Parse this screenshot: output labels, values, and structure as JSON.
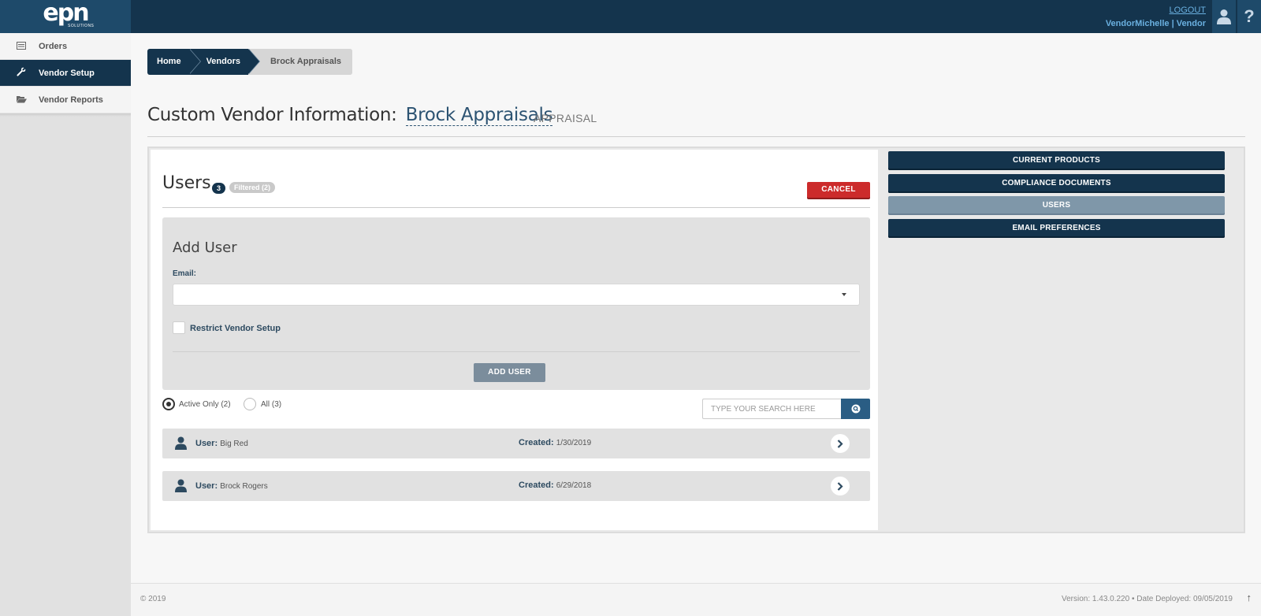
{
  "header": {
    "logo_text": "epn",
    "logo_sub": "SOLUTIONS",
    "logout_label": "LOGOUT",
    "user_label": "VendorMichelle | Vendor",
    "user_icon": "user-icon",
    "help_icon": "help-icon",
    "help_glyph": "?"
  },
  "sidebar": {
    "items": [
      {
        "label": "Orders",
        "icon": "list-icon",
        "glyph": "▤",
        "active": false
      },
      {
        "label": "Vendor Setup",
        "icon": "wrench-icon",
        "glyph": "🔧",
        "active": true
      },
      {
        "label": "Vendor Reports",
        "icon": "folder-open-icon",
        "glyph": "📂",
        "active": false
      }
    ]
  },
  "breadcrumb": [
    "Home",
    "Vendors",
    "Brock Appraisals"
  ],
  "title": {
    "prefix": "Custom Vendor Information:",
    "vendor": "Brock Appraisals",
    "type": "APPRAISAL"
  },
  "users_panel": {
    "heading": "Users",
    "count": "3",
    "filtered": "Filtered (2)",
    "cancel_label": "CANCEL",
    "add_user": {
      "title": "Add User",
      "email_label": "Email:",
      "email_value": "",
      "restrict_label": "Restrict Vendor Setup",
      "restrict_checked": false,
      "button_label": "ADD USER"
    },
    "filters": {
      "active_label": "Active Only (2)",
      "all_label": "All (3)",
      "selected": "active"
    },
    "search": {
      "placeholder": "TYPE YOUR SEARCH HERE",
      "icon": "search-icon"
    },
    "rows": [
      {
        "user_label": "User:",
        "name": "Big Red",
        "created_label": "Created:",
        "created": "1/30/2019"
      },
      {
        "user_label": "User:",
        "name": "Brock Rogers",
        "created_label": "Created:",
        "created": "6/29/2018"
      }
    ]
  },
  "right_nav": [
    {
      "label": "CURRENT PRODUCTS",
      "active": false
    },
    {
      "label": "COMPLIANCE DOCUMENTS",
      "active": false
    },
    {
      "label": "USERS",
      "active": true
    },
    {
      "label": "EMAIL PREFERENCES",
      "active": false
    }
  ],
  "footer": {
    "copyright": "© 2019",
    "version": "Version: 1.43.0.220  •  Date Deployed: 09/05/2019",
    "up_glyph": "↑"
  },
  "colors": {
    "navy": "#14344d",
    "cancel_red": "#cc2b2b",
    "active_tab": "#7f97a9"
  }
}
